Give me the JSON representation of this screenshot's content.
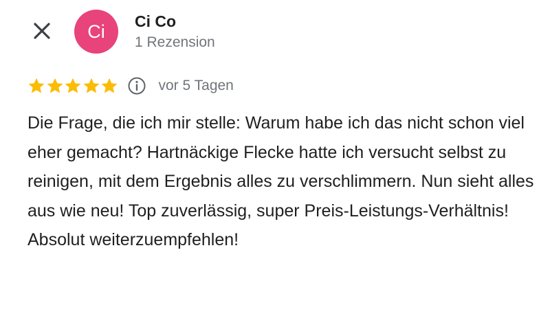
{
  "header": {
    "close_icon": "close-icon",
    "avatar_initials": "Ci",
    "avatar_color": "#e8437a",
    "author_name": "Ci Co",
    "review_count": "1 Rezension"
  },
  "rating": {
    "stars": 5,
    "max_stars": 5,
    "star_color": "#fbbc04",
    "info_icon": "info-icon",
    "time_ago": "vor 5 Tagen"
  },
  "review": {
    "text": "Die Frage, die ich mir stelle: Warum habe ich das nicht schon viel eher gemacht? Hartnäckige Flecke hatte ich versucht selbst zu reinigen, mit dem Ergebnis alles zu verschlimmern. Nun sieht alles aus wie neu! Top zuverlässig, super Preis-Leistungs-Verhältnis! Absolut weiterzuempfehlen!"
  }
}
